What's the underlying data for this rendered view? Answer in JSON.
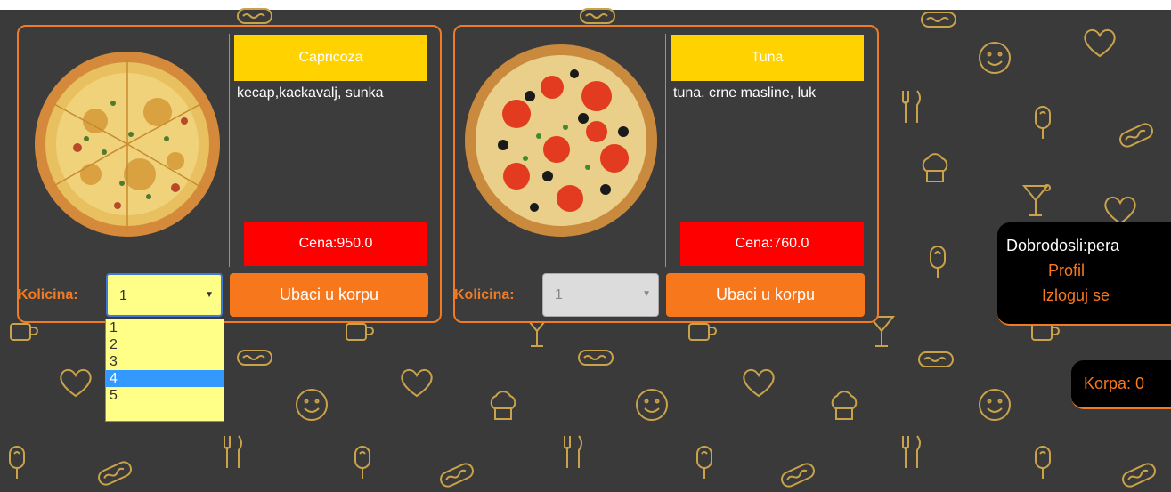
{
  "products": [
    {
      "title": "Capricoza",
      "description": "kecap,kackavalj, sunka",
      "price": "Cena:950.0",
      "quantity_label": "Kolicina:",
      "quantity_value": "1",
      "add_button": "Ubaci u korpu",
      "image": "pizza-capricciosa"
    },
    {
      "title": "Tuna",
      "description": "tuna. crne masline, luk",
      "price": "Cena:760.0",
      "quantity_label": "Kolicina:",
      "quantity_value": "1",
      "add_button": "Ubaci u korpu",
      "image": "pizza-tuna"
    }
  ],
  "quantity_dropdown": {
    "options": [
      "1",
      "2",
      "3",
      "4",
      "5"
    ],
    "highlighted": "4"
  },
  "user_panel": {
    "welcome": "Dobrodosli:pera",
    "profile_link": "Profil",
    "logout_link": "Izloguj se"
  },
  "cart": {
    "label": "Korpa: 0"
  },
  "colors": {
    "background": "#3a3a3a",
    "accent": "#f7781c",
    "title_bar": "#ffd200",
    "price_bar": "#ff0000",
    "pattern": "#c9a24a"
  },
  "background_icons": [
    "hotdog-icon",
    "heart-icon",
    "smiley-icon",
    "ice-cream-icon",
    "cutlery-icon",
    "chef-hat-icon",
    "cocktail-icon",
    "mug-icon"
  ]
}
